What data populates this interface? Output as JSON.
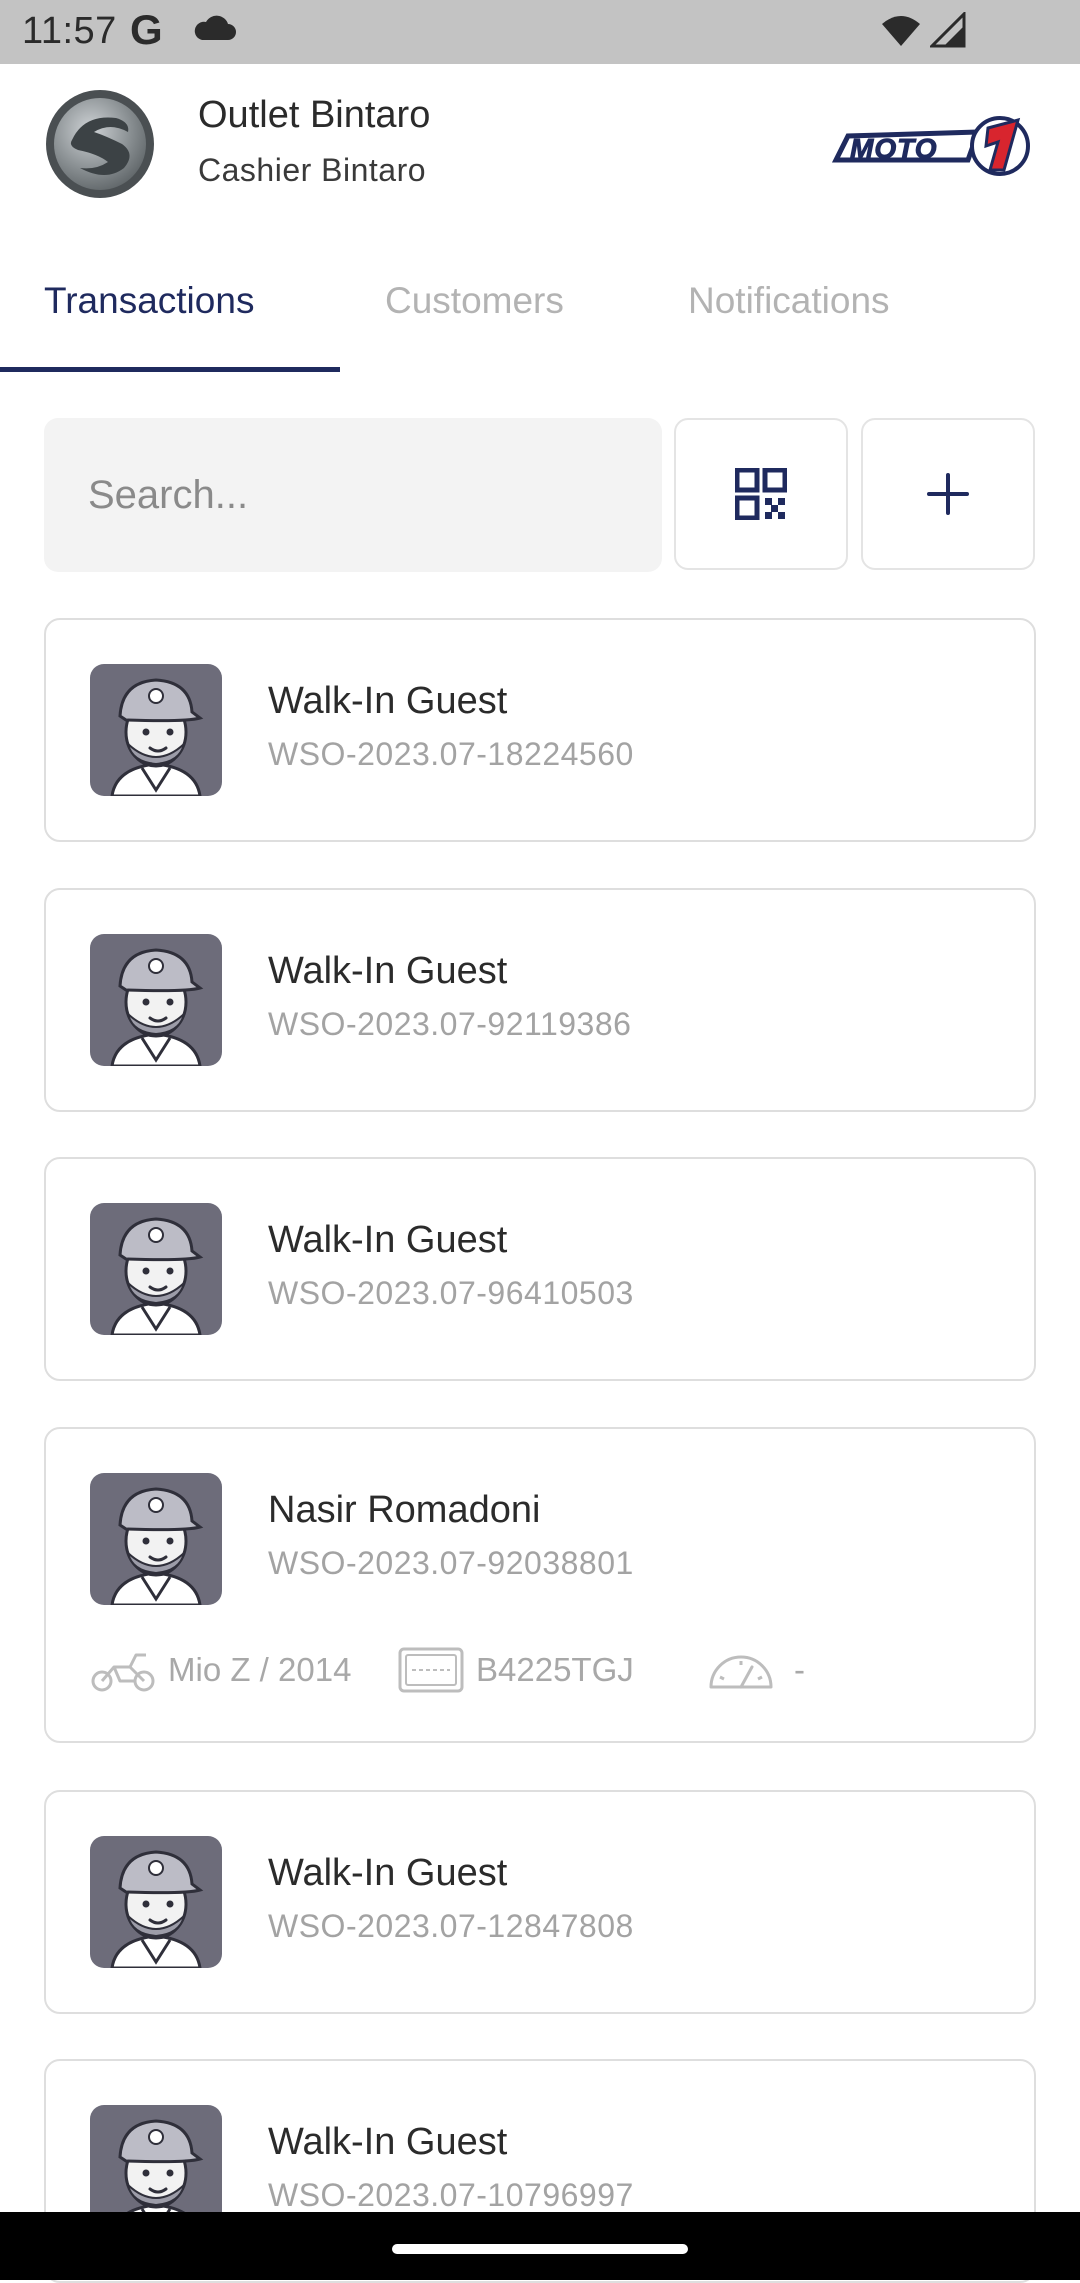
{
  "status_bar": {
    "time": "11:57",
    "google_letter": "G"
  },
  "header": {
    "outlet_name": "Outlet Bintaro",
    "cashier_name": "Cashier Bintaro",
    "brand_logo_text": "MOTO 1"
  },
  "tabs": [
    {
      "label": "Transactions",
      "active": true
    },
    {
      "label": "Customers",
      "active": false
    },
    {
      "label": "Notifications",
      "active": false
    }
  ],
  "search": {
    "placeholder": "Search..."
  },
  "transactions": [
    {
      "name": "Walk-In Guest",
      "code": "WSO-2023.07-18224560"
    },
    {
      "name": "Walk-In Guest",
      "code": "WSO-2023.07-92119386"
    },
    {
      "name": "Walk-In Guest",
      "code": "WSO-2023.07-96410503"
    },
    {
      "name": "Nasir Romadoni",
      "code": "WSO-2023.07-92038801",
      "vehicle": "Mio Z / 2014",
      "plate": "B4225TGJ",
      "odometer": "-"
    },
    {
      "name": "Walk-In Guest",
      "code": "WSO-2023.07-12847808"
    },
    {
      "name": "Walk-In Guest",
      "code": "WSO-2023.07-10796997"
    }
  ],
  "colors": {
    "accent": "#1f2a5e",
    "brand_red": "#d8252e",
    "avatar_bg": "#6d6c7a"
  }
}
